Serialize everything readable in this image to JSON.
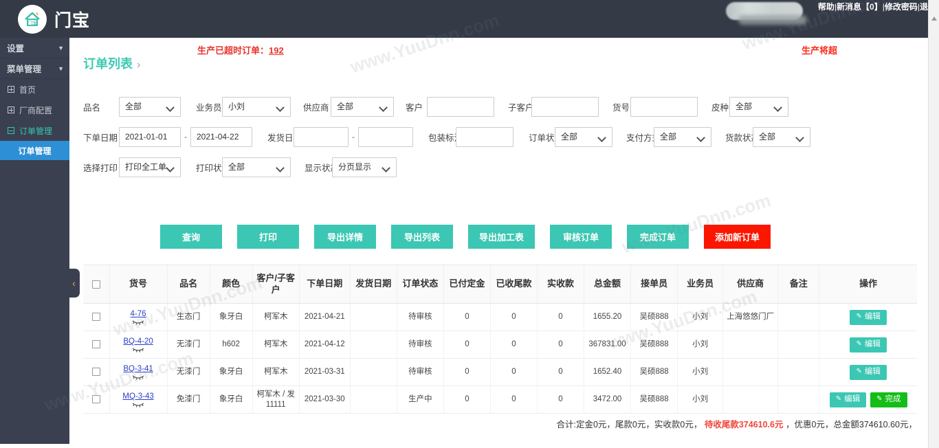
{
  "topbar": {
    "brand": "门宝",
    "logo_icon": "house-logo-icon",
    "nav": [
      {
        "label": "帮助"
      },
      {
        "label": "新消息【0】"
      },
      {
        "label": "修改密码"
      },
      {
        "label": "退出"
      }
    ],
    "separator": "|"
  },
  "sidebar": {
    "groups": [
      {
        "label": "设置",
        "caret": "▼"
      },
      {
        "label": "菜单管理",
        "caret": "▼"
      }
    ],
    "items": [
      {
        "label": "首页",
        "icon": "expand-plus-icon"
      },
      {
        "label": "厂商配置",
        "icon": "expand-plus-icon"
      },
      {
        "label": "订单管理",
        "icon": "collapse-minus-icon"
      }
    ],
    "sub_items": [
      {
        "label": "订单管理"
      }
    ],
    "collapse_handle": "‹"
  },
  "alerts": {
    "overtime_label": "生产已超时订单：",
    "overtime_count": "192",
    "upcoming": "生产将超"
  },
  "page": {
    "title": "订单列表",
    "chevron": "›"
  },
  "filters": {
    "row1": {
      "pinming_label": "品名",
      "pinming_value": "全部",
      "yewuyuan_label": "业务员",
      "yewuyuan_value": "小刘",
      "gongyingshang_label": "供应商",
      "gongyingshang_value": "全部",
      "kehu_label": "客户",
      "kehu_value": "",
      "kehu_placeholder": "",
      "zikehu_label": "子客户",
      "zikehu_value": "",
      "huohao_label": "货号",
      "huohao_value": "",
      "pizhong_label": "皮种",
      "pizhong_value": "全部"
    },
    "row2": {
      "xiadanriqi_label": "下单日期",
      "xiadanriqi_from": "2021-01-01",
      "xiadanriqi_to": "2021-04-22",
      "dash": "-",
      "fahuoriqi_label": "发货日期",
      "fahuoriqi_from": "",
      "fahuoriqi_to": "",
      "baozhuangbiaozhu_label": "包装标注",
      "baozhuangbiaozhu_value": "",
      "dingdanzhuangtai_label": "订单状态",
      "dingdanzhuangtai_value": "全部",
      "zhifufangshi_label": "支付方式",
      "zhifufangshi_value": "全部",
      "huokuanzhuangtai_label": "货款状态",
      "huokuanzhuangtai_value": "全部"
    },
    "row3": {
      "xuanzedayin_label": "选择打印",
      "xuanzedayin_value": "打印全工单",
      "dayinzhuangtai_label": "打印状态",
      "dayinzhuangtai_value": "全部",
      "xianshizhuangtai_label": "显示状态",
      "xianshizhuangtai_value": "分页显示"
    }
  },
  "buttons": [
    {
      "label": "查询",
      "style": "teal"
    },
    {
      "label": "打印",
      "style": "teal"
    },
    {
      "label": "导出详情",
      "style": "teal"
    },
    {
      "label": "导出列表",
      "style": "teal"
    },
    {
      "label": "导出加工表",
      "style": "teal"
    },
    {
      "label": "审核订单",
      "style": "teal"
    },
    {
      "label": "完成订单",
      "style": "teal"
    },
    {
      "label": "添加新订单",
      "style": "red"
    }
  ],
  "table": {
    "columns": [
      "",
      "货号",
      "品名",
      "颜色",
      "客户/子客户",
      "下单日期",
      "发货日期",
      "订单状态",
      "已付定金",
      "已收尾款",
      "实收款",
      "总金额",
      "接单员",
      "业务员",
      "供应商",
      "备注",
      "操作"
    ],
    "rows": [
      {
        "code": "4-76",
        "pinming": "生态门",
        "color": "象牙白",
        "customer": "柯军木",
        "order_date": "2021-04-21",
        "ship_date": "",
        "status": "待审核",
        "deposit": "0",
        "balance": "0",
        "received": "0",
        "total": "1655.20",
        "taker": "吴硕888",
        "sales": "小刘",
        "supplier": "上海悠悠门厂",
        "remark": "",
        "actions": [
          {
            "label": "编辑",
            "style": "teal"
          }
        ]
      },
      {
        "code": "BQ-4-20",
        "pinming": "无漆门",
        "color": "h602",
        "customer": "柯军木",
        "order_date": "2021-04-12",
        "ship_date": "",
        "status": "待审核",
        "deposit": "0",
        "balance": "0",
        "received": "0",
        "total": "367831.00",
        "taker": "吴硕888",
        "sales": "小刘",
        "supplier": "",
        "remark": "",
        "actions": [
          {
            "label": "编辑",
            "style": "teal"
          }
        ]
      },
      {
        "code": "BQ-3-41",
        "pinming": "无漆门",
        "color": "象牙白",
        "customer": "柯军木",
        "order_date": "2021-03-31",
        "ship_date": "",
        "status": "待审核",
        "deposit": "0",
        "balance": "0",
        "received": "0",
        "total": "1652.40",
        "taker": "吴硕888",
        "sales": "小刘",
        "supplier": "",
        "remark": "",
        "actions": [
          {
            "label": "编辑",
            "style": "teal"
          }
        ]
      },
      {
        "code": "MQ-3-43",
        "pinming": "免漆门",
        "color": "象牙白",
        "customer": "柯军木 / 发11111",
        "order_date": "2021-03-30",
        "ship_date": "",
        "status": "生产中",
        "deposit": "0",
        "balance": "0",
        "received": "0",
        "total": "3472.00",
        "taker": "吴硕888",
        "sales": "小刘",
        "supplier": "",
        "remark": "",
        "actions": [
          {
            "label": "编辑",
            "style": "teal"
          },
          {
            "label": "完成",
            "style": "green"
          }
        ]
      }
    ]
  },
  "summary": {
    "prefix": "合计:定金0元，尾款0元，实收款0元，",
    "highlight": "待收尾款374610.6元",
    "suffix": "，优惠0元，总金额374610.60元，"
  },
  "watermarks": [
    "www.YuuDnn.com",
    "www.YuuDnn.com",
    "www.YuuDnn.com",
    "www.YuuDnn.com",
    "www.YuuDnn.com",
    "www.YuuDnn.com"
  ],
  "colors": {
    "brand_dark": "#343a46",
    "sidebar": "#3a4050",
    "teal": "#3bc7b3",
    "red": "#fb1600",
    "green": "#14bd18",
    "active_blue": "#2d8fd5",
    "alert_red": "#e8342c"
  }
}
